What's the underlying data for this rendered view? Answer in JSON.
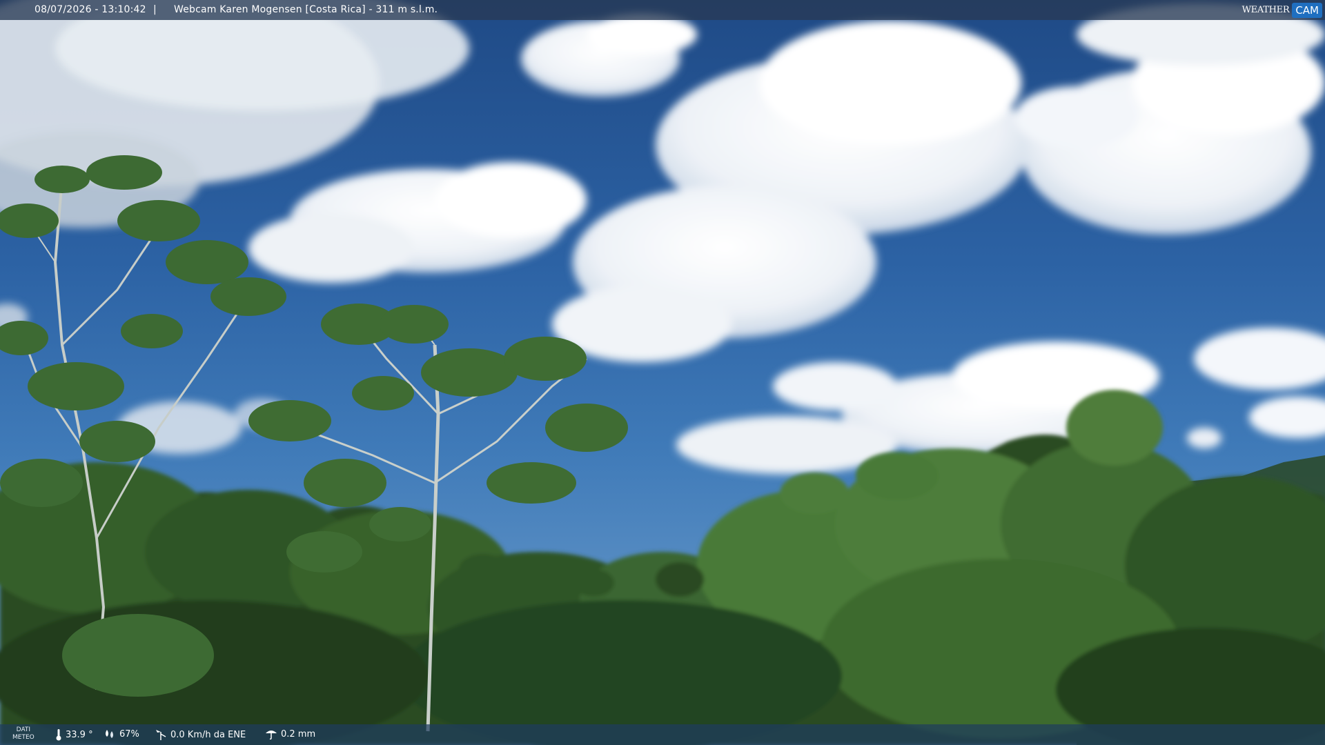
{
  "overlay": {
    "datetime": "08/07/2026 - 13:10:42",
    "separator": "|",
    "title": "Webcam Karen Mogensen [Costa Rica] - 311 m s.l.m.",
    "logo_text": "WEATHER",
    "logo_cam": "CAM"
  },
  "weather": {
    "dati_line1": "DATI",
    "dati_line2": "METEO",
    "temperature": "33.9 °",
    "humidity": "67%",
    "wind": "0.0 Km/h da ENE",
    "rain": "0.2 mm"
  },
  "icons": {
    "temperature": "thermometer-icon",
    "humidity": "humidity-icon",
    "wind": "wind-vane-icon",
    "rain": "rain-gauge-icon"
  },
  "colors": {
    "sky_top": "#1f4a86",
    "sky_bottom": "#6e9dc9",
    "cloud": "#f4f7fb",
    "forest_dark": "#1d3a1a",
    "forest_mid": "#2f5a26",
    "forest_light": "#4f7d3a",
    "logo_blue": "#1f6fc0"
  }
}
